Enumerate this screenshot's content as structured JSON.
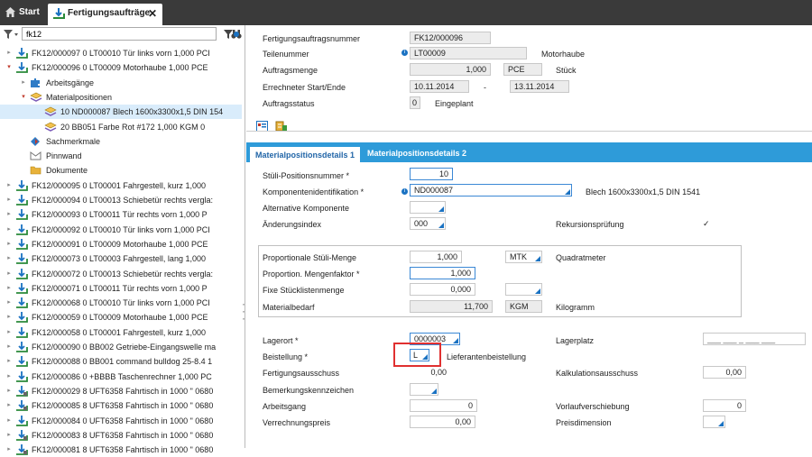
{
  "tabs": {
    "start": "Start",
    "active": "Fertigungsaufträge"
  },
  "search": {
    "value": "fk12"
  },
  "tree": [
    {
      "text": "FK12/000097  0  LT00010  Tür links vorn  1,000  PCI",
      "level": 0,
      "arrow": "▸",
      "icon": "order"
    },
    {
      "text": "FK12/000096  0  LT00009  Motorhaube  1,000  PCE",
      "level": 0,
      "arrow": "▾",
      "icon": "order-red"
    },
    {
      "text": "Arbeitsgänge",
      "level": 1,
      "arrow": "▸",
      "icon": "puzzle"
    },
    {
      "text": "Materialpositionen",
      "level": 1,
      "arrow": "▾",
      "icon": "material"
    },
    {
      "text": "10  ND000087  Blech 1600x3300x1,5 DIN 154",
      "level": 2,
      "arrow": "",
      "icon": "material",
      "selected": true
    },
    {
      "text": "20  BB051  Farbe Rot #172  1,000  KGM  0",
      "level": 2,
      "arrow": "",
      "icon": "material"
    },
    {
      "text": "Sachmerkmale",
      "level": 1,
      "arrow": "",
      "icon": "diamond"
    },
    {
      "text": "Pinnwand",
      "level": 1,
      "arrow": "",
      "icon": "pin"
    },
    {
      "text": "Dokumente",
      "level": 1,
      "arrow": "",
      "icon": "folder"
    },
    {
      "text": "FK12/000095  0  LT00001  Fahrgestell, kurz  1,000",
      "level": 0,
      "arrow": "▸",
      "icon": "order"
    },
    {
      "text": "FK12/000094  0  LT00013  Schiebetür rechts vergla:",
      "level": 0,
      "arrow": "▸",
      "icon": "order"
    },
    {
      "text": "FK12/000093  0  LT00011  Tür rechts vorn  1,000  P",
      "level": 0,
      "arrow": "▸",
      "icon": "order"
    },
    {
      "text": "FK12/000092  0  LT00010  Tür links vorn  1,000  PCI",
      "level": 0,
      "arrow": "▸",
      "icon": "order"
    },
    {
      "text": "FK12/000091  0  LT00009  Motorhaube  1,000  PCE",
      "level": 0,
      "arrow": "▸",
      "icon": "order"
    },
    {
      "text": "FK12/000073  0  LT00003  Fahrgestell, lang  1,000",
      "level": 0,
      "arrow": "▸",
      "icon": "order"
    },
    {
      "text": "FK12/000072  0  LT00013  Schiebetür rechts vergla:",
      "level": 0,
      "arrow": "▸",
      "icon": "order"
    },
    {
      "text": "FK12/000071  0  LT00011  Tür rechts vorn  1,000  P",
      "level": 0,
      "arrow": "▸",
      "icon": "order"
    },
    {
      "text": "FK12/000068  0  LT00010  Tür links vorn  1,000  PCI",
      "level": 0,
      "arrow": "▸",
      "icon": "order"
    },
    {
      "text": "FK12/000059  0  LT00009  Motorhaube  1,000  PCE",
      "level": 0,
      "arrow": "▸",
      "icon": "order"
    },
    {
      "text": "FK12/000058  0  LT00001  Fahrgestell, kurz  1,000",
      "level": 0,
      "arrow": "▸",
      "icon": "order"
    },
    {
      "text": "FK12/000090  0  BB002  Getriebe-Eingangswelle ma",
      "level": 0,
      "arrow": "▸",
      "icon": "order"
    },
    {
      "text": "FK12/000088  0  BB001  command bulldog 25-8.4  1",
      "level": 0,
      "arrow": "▸",
      "icon": "order"
    },
    {
      "text": "FK12/000086  0  +BBBB  Taschenrechner  1,000  PC",
      "level": 0,
      "arrow": "▸",
      "icon": "order"
    },
    {
      "text": "FK12/000029  8  UFT6358  Fahrtisch in 1000 \" 0680",
      "level": 0,
      "arrow": "▸",
      "icon": "order-alt"
    },
    {
      "text": "FK12/000085  8  UFT6358  Fahrtisch in 1000 \" 0680",
      "level": 0,
      "arrow": "▸",
      "icon": "order-alt"
    },
    {
      "text": "FK12/000084  0  UFT6358  Fahrtisch in 1000 \" 0680",
      "level": 0,
      "arrow": "▸",
      "icon": "order"
    },
    {
      "text": "FK12/000083  8  UFT6358  Fahrtisch in 1000 \" 0680",
      "level": 0,
      "arrow": "▸",
      "icon": "order-alt"
    },
    {
      "text": "FK12/000081  8  UFT6358  Fahrtisch in 1000 \" 0680",
      "level": 0,
      "arrow": "▸",
      "icon": "order-alt"
    }
  ],
  "header": {
    "order_no_label": "Fertigungsauftragsnummer",
    "order_no": "FK12/000096",
    "part_label": "Teilenummer",
    "part": "LT00009",
    "part_desc": "Motorhaube",
    "qty_label": "Auftragsmenge",
    "qty": "1,000",
    "qty_unit": "PCE",
    "qty_unit_desc": "Stück",
    "dates_label": "Errechneter Start/Ende",
    "start": "10.11.2014",
    "dash": "-",
    "end": "13.11.2014",
    "status_label": "Auftragsstatus",
    "status": "0",
    "status_desc": "Eingeplant"
  },
  "detail_tabs": [
    "Materialpositionsdetails 1",
    "Materialpositionsdetails 2"
  ],
  "details": {
    "pos_label": "Stüli-Positionsnummer *",
    "pos": "10",
    "comp_label": "Komponentenidentifikation *",
    "comp": "ND000087",
    "comp_desc": "Blech 1600x3300x1,5 DIN 1541",
    "alt_label": "Alternative Komponente",
    "change_label": "Änderungsindex",
    "change": "000",
    "recursion_label": "Rekursionsprüfung",
    "recursion_check": "✓",
    "prop_qty_label": "Proportionale Stüli-Menge",
    "prop_qty": "1,000",
    "prop_unit": "MTK",
    "prop_unit_desc": "Quadratmeter",
    "prop_factor_label": "Proportion. Mengenfaktor *",
    "prop_factor": "1,000",
    "fixed_label": "Fixe Stücklistenmenge",
    "fixed": "0,000",
    "need_label": "Materialbedarf",
    "need": "11,700",
    "need_unit": "KGM",
    "need_unit_desc": "Kilogramm",
    "store_label": "Lagerort *",
    "store": "0000003",
    "place_label": "Lagerplatz",
    "place": "___ ___ _ ___ ___",
    "order_label": "Beistellung *",
    "order": "L",
    "order_desc": "Lieferantenbeistellung",
    "scrap_label": "Fertigungsausschuss",
    "scrap": "0,00",
    "calc_label": "Kalkulationsausschuss",
    "calc": "0,00",
    "mark_label": "Bemerkungskennzeichen",
    "op_label": "Arbeitsgang",
    "op": "0",
    "shift_label": "Vorlaufverschiebung",
    "shift": "0",
    "price_label": "Verrechnungspreis",
    "price": "0,00",
    "pricedim_label": "Preisdimension"
  }
}
